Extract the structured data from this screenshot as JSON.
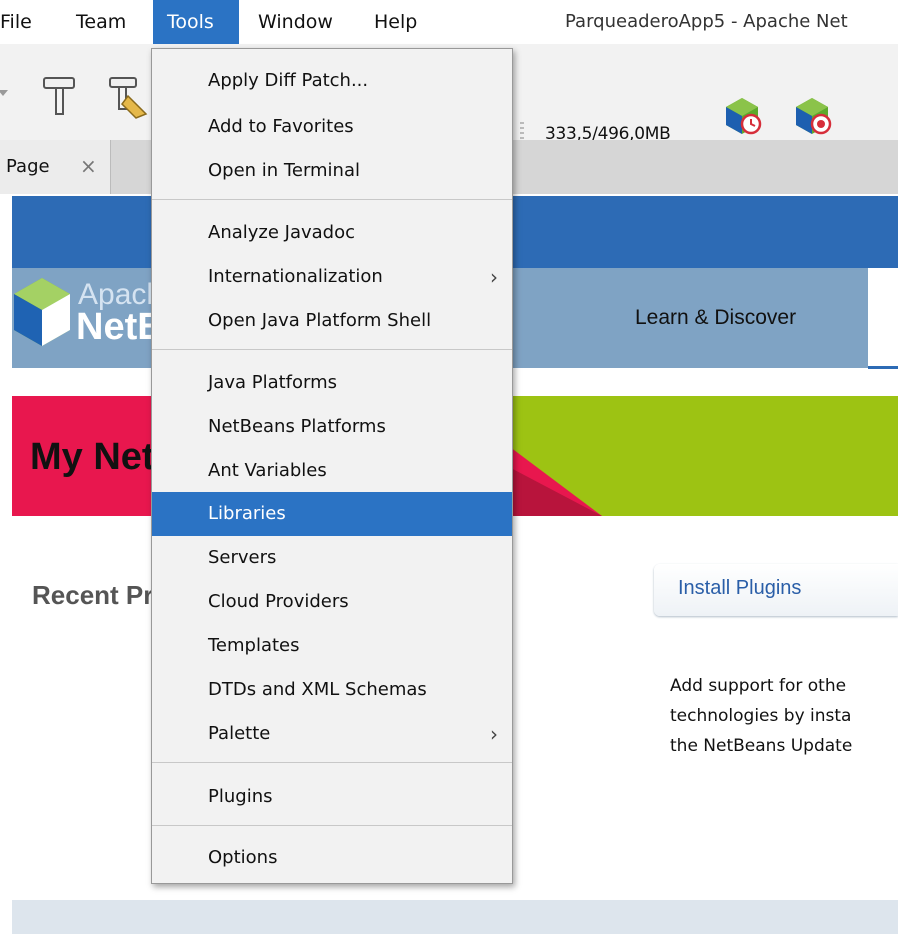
{
  "window": {
    "title": "ParqueaderoApp5 - Apache Net"
  },
  "menubar": {
    "items": [
      {
        "label": "File"
      },
      {
        "label": "Team"
      },
      {
        "label": "Tools"
      },
      {
        "label": "Window"
      },
      {
        "label": "Help"
      }
    ],
    "active": "Tools"
  },
  "toolbar": {
    "memory": "333,5/496,0MB",
    "icons": [
      "clean-build-icon",
      "build-hammer-icon",
      "profile-icon",
      "profile-memory-icon"
    ]
  },
  "tabs": [
    {
      "label": "Start Page",
      "visible_label": "Page",
      "close": "×"
    }
  ],
  "start_page": {
    "logo_top": "Apache",
    "logo_bottom": "NetBeans",
    "nav_link": "Learn & Discover",
    "banner_title": "My NetBeans",
    "recent_title": "Recent Projects",
    "install_link": "Install Plugins",
    "install_desc": [
      "Add support for othe",
      "technologies by insta",
      "the NetBeans Update"
    ]
  },
  "tools_menu": {
    "groups": [
      [
        {
          "label": "Apply Diff Patch..."
        },
        {
          "label": "Add to Favorites"
        },
        {
          "label": "Open in Terminal"
        }
      ],
      [
        {
          "label": "Analyze Javadoc"
        },
        {
          "label": "Internationalization",
          "submenu": true
        },
        {
          "label": "Open Java Platform Shell"
        }
      ],
      [
        {
          "label": "Java Platforms"
        },
        {
          "label": "NetBeans Platforms"
        },
        {
          "label": "Ant Variables"
        },
        {
          "label": "Libraries",
          "selected": true
        },
        {
          "label": "Servers"
        },
        {
          "label": "Cloud Providers"
        },
        {
          "label": "Templates"
        },
        {
          "label": "DTDs and XML Schemas"
        },
        {
          "label": "Palette",
          "submenu": true
        }
      ],
      [
        {
          "label": "Plugins"
        }
      ],
      [
        {
          "label": "Options"
        }
      ]
    ],
    "submenu_glyph": "›"
  },
  "colors": {
    "selection": "#2b73c4",
    "banner_pink": "#e8174e",
    "banner_green": "#9dc313",
    "header_blue": "#2d6bb5"
  }
}
